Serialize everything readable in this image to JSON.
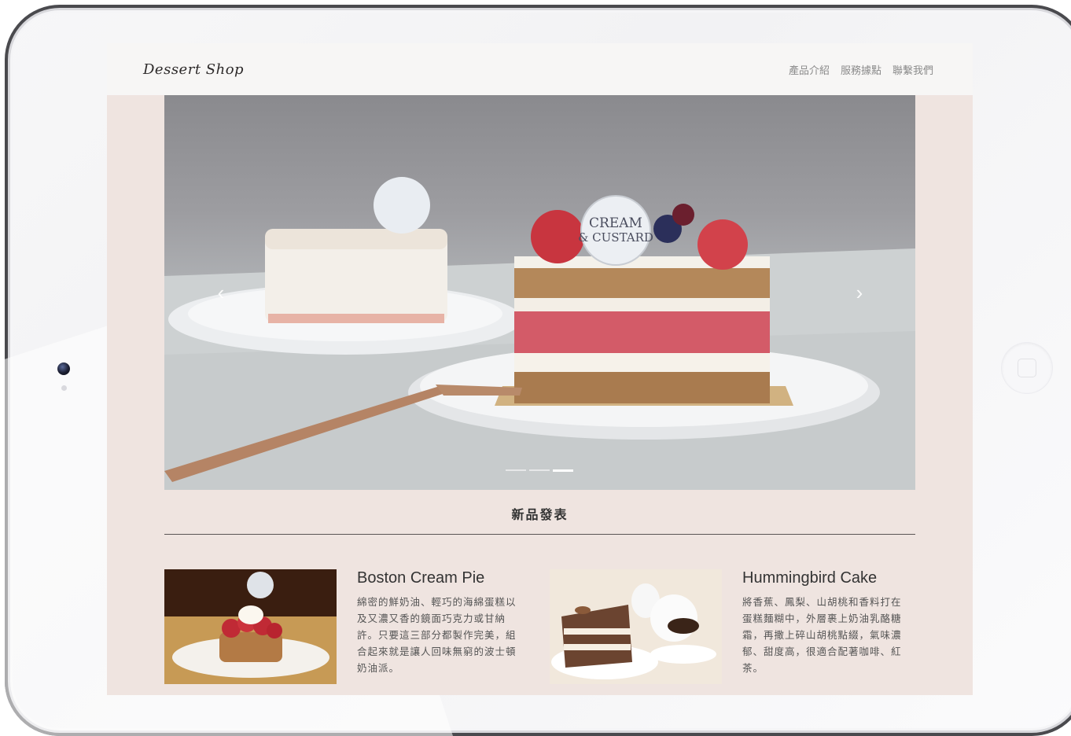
{
  "brand": {
    "logo_text": "Dessert Shop"
  },
  "nav": {
    "items": [
      {
        "label": "產品介紹"
      },
      {
        "label": "服務據點"
      },
      {
        "label": "聯繫我們"
      }
    ]
  },
  "hero": {
    "badge_line1": "CREAM",
    "badge_line2": "& CUSTARD",
    "prev_icon": "chevron-left-icon",
    "next_icon": "chevron-right-icon",
    "prev_glyph": "‹",
    "next_glyph": "›",
    "slide_count": 3,
    "active_slide": 3
  },
  "section": {
    "title": "新品發表"
  },
  "products": [
    {
      "name": "Boston Cream Pie",
      "description": "綿密的鮮奶油、輕巧的海綿蛋糕以及又濃又香的鏡面巧克力或甘納許。只要這三部分都製作完美，組合起來就是讓人回味無窮的波士頓奶油派。"
    },
    {
      "name": "Hummingbird Cake",
      "description": "將香蕉、鳳梨、山胡桃和香料打在蛋糕麵糊中，外層裹上奶油乳酪糖霜，再撒上碎山胡桃點綴，氣味濃郁、甜度高，很適合配著咖啡、紅茶。"
    }
  ],
  "colors": {
    "page_background": "#efe4e0",
    "navbar_background": "#f7f6f5",
    "nav_text": "#8b8b8b",
    "divider": "#5a5454"
  }
}
